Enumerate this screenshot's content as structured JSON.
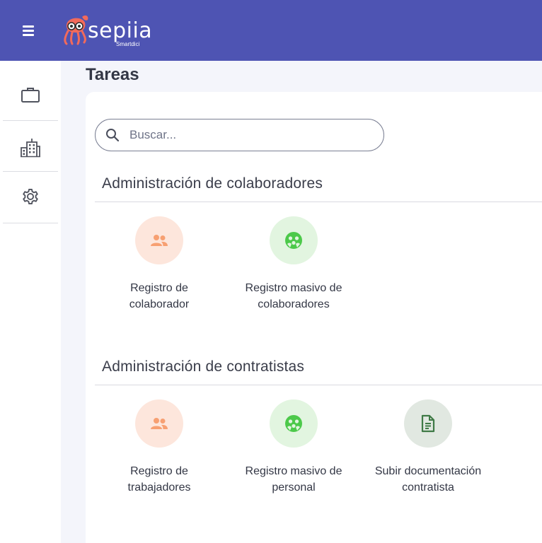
{
  "header": {
    "logo_text": "sepiia",
    "logo_subtitle": "Smartdici"
  },
  "sidebar": {
    "items": [
      {
        "name": "briefcase-icon"
      },
      {
        "name": "buildings-icon"
      },
      {
        "name": "gear-icon"
      }
    ]
  },
  "page": {
    "title": "Tareas"
  },
  "search": {
    "placeholder": "Buscar..."
  },
  "sections": [
    {
      "title": "Administración de colaboradores",
      "tasks": [
        {
          "label": "Registro de colaborador",
          "icon": "people-icon",
          "color": "#f7a072"
        },
        {
          "label": "Registro masivo de colaboradores",
          "icon": "group-circle-icon",
          "color": "#4cc94a"
        }
      ]
    },
    {
      "title": "Administración de contratistas",
      "tasks": [
        {
          "label": "Registro de trabajadores",
          "icon": "people-icon",
          "color": "#f7a072"
        },
        {
          "label": "Registro masivo de personal",
          "icon": "group-circle-icon",
          "color": "#4cc94a"
        },
        {
          "label": "Subir documentación contratista",
          "icon": "document-icon",
          "color": "#3f7a46"
        }
      ]
    }
  ]
}
